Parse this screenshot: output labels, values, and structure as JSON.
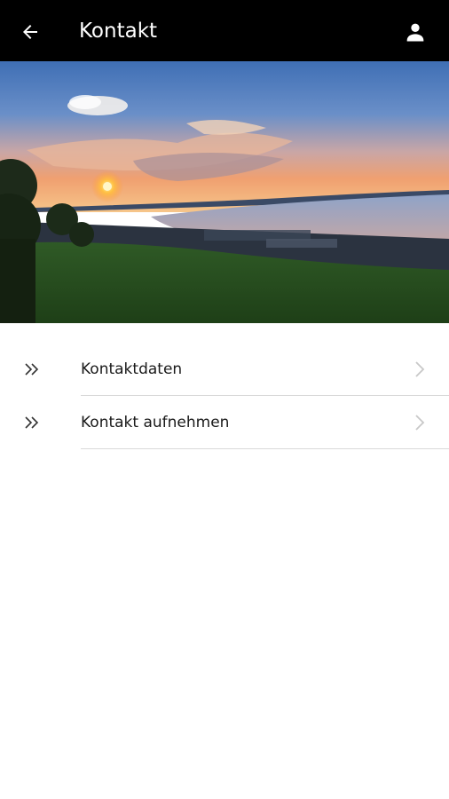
{
  "appbar": {
    "title": "Kontakt",
    "back_icon": "arrow-left-icon",
    "profile_icon": "person-icon",
    "background": "#000000"
  },
  "hero": {
    "image": "sunset-over-lake-landscape"
  },
  "menu": {
    "items": [
      {
        "label": "Kontaktdaten",
        "lead_icon": "double-chevron-right-icon",
        "trail_icon": "chevron-right-icon"
      },
      {
        "label": "Kontakt aufnehmen",
        "lead_icon": "double-chevron-right-icon",
        "trail_icon": "chevron-right-icon"
      }
    ]
  }
}
